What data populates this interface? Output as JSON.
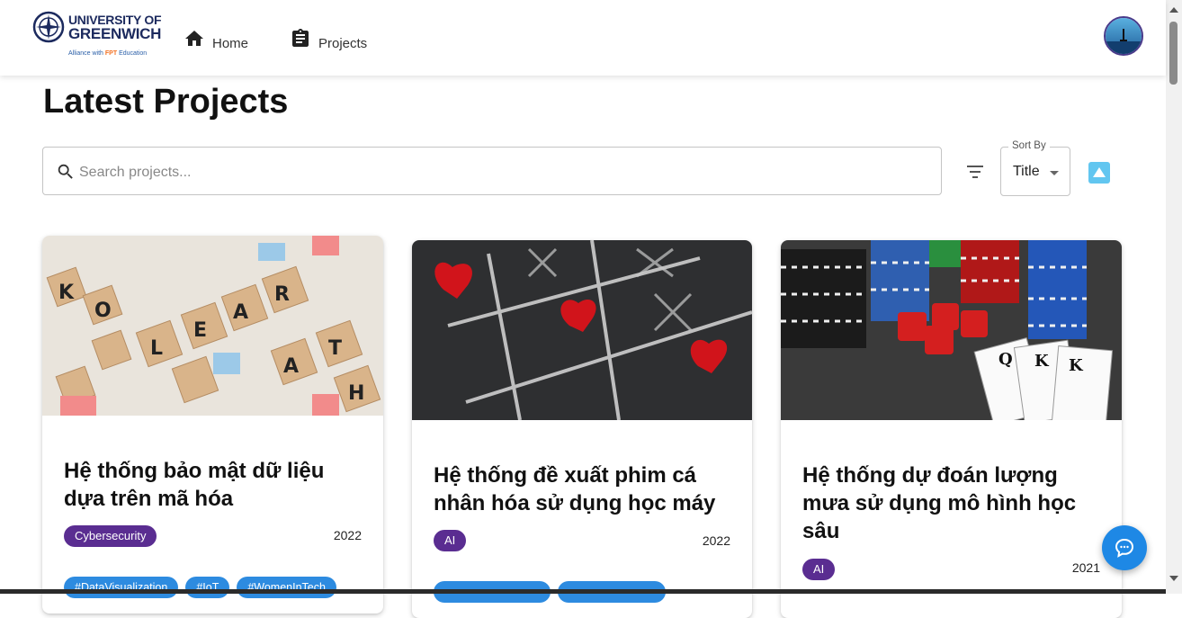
{
  "header": {
    "logo": {
      "line1": "UNIVERSITY OF",
      "line2": "GREENWICH",
      "alliance_prefix": "Alliance with",
      "alliance_brand": "FPT",
      "alliance_suffix": "Education"
    },
    "nav": [
      {
        "label": "Home",
        "icon": "home-icon"
      },
      {
        "label": "Projects",
        "icon": "clipboard-icon"
      }
    ],
    "avatar_icon": "user-avatar"
  },
  "page": {
    "title": "Latest Projects"
  },
  "search": {
    "placeholder": "Search projects...",
    "value": ""
  },
  "sort": {
    "legend": "Sort By",
    "selected": "Title",
    "direction_icon": "sort-ascending-icon"
  },
  "projects": [
    {
      "title": "Hệ thống bảo mật dữ liệu dựa trên mã hóa",
      "category": "Cybersecurity",
      "year": "2022",
      "tags": [
        "#DataVisualization",
        "#IoT",
        "#WomenInTech"
      ]
    },
    {
      "title": "Hệ thống đề xuất phim cá nhân hóa sử dụng học máy",
      "category": "AI",
      "year": "2022",
      "tags": [
        "",
        ""
      ]
    },
    {
      "title": "Hệ thống dự đoán lượng mưa sử dụng mô hình học sâu",
      "category": "AI",
      "year": "2021",
      "tags": []
    }
  ],
  "colors": {
    "category_bg": "#5a2d91",
    "tag_bg": "#2d8be0",
    "fab_bg": "#1e88e5",
    "sort_dir_bg": "#62c6f0"
  }
}
